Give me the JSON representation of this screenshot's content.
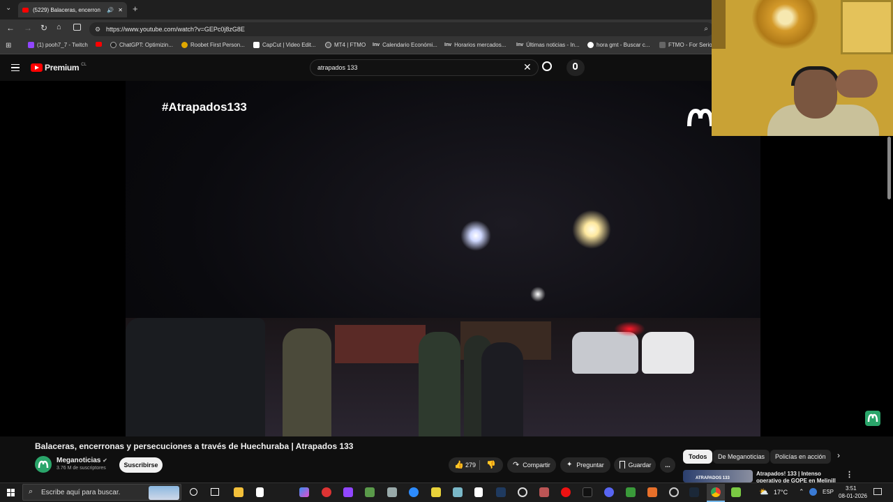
{
  "browser": {
    "tab_title": "(5229) Balaceras, encerron",
    "url": "https://www.youtube.com/watch?v=GEPc0j8zG8E",
    "bookmarks": [
      "(1) pooh7_7 - Twitch",
      "ChatGPT: Optimizin...",
      "Roobet First Person...",
      "CapCut | Video Edit...",
      "MT4 | FTMO",
      "Calendario Económi...",
      "Horarios mercados...",
      "Últimas noticias - In...",
      "hora gmt - Buscar c...",
      "FTMO - For Serio"
    ],
    "bookmark_prefix_inv": "Inv"
  },
  "youtube": {
    "logo_text": "Premium",
    "logo_sup": "CL",
    "search_value": "atrapados 133",
    "video_overlay": "#Atrapados133",
    "video_title": "Balaceras, encerronas y persecuciones a través de Huechuraba | Atrapados 133",
    "channel_name": "Meganoticias",
    "subscribers": "3.76 M de suscriptores",
    "subscribe_label": "Suscribirse",
    "likes": "279",
    "share_label": "Compartir",
    "ask_label": "Preguntar",
    "save_label": "Guardar",
    "more_label": "...",
    "chips": [
      "Todos",
      "De Meganoticias",
      "Policías en acción"
    ],
    "related_title": "Atrapados! 133 | Intenso operativo de GOPE en Melinill",
    "related_thumb_text": "ATRAPADOS 133"
  },
  "taskbar": {
    "search_placeholder": "Escribe aquí para buscar.",
    "temperature": "17°C",
    "language": "ESP",
    "time": "3:51",
    "date": "08-01-2026"
  },
  "colors": {
    "brand_red": "#ff0000",
    "chip_active": "#f1f1f1",
    "accent": "#3ea6ff"
  }
}
